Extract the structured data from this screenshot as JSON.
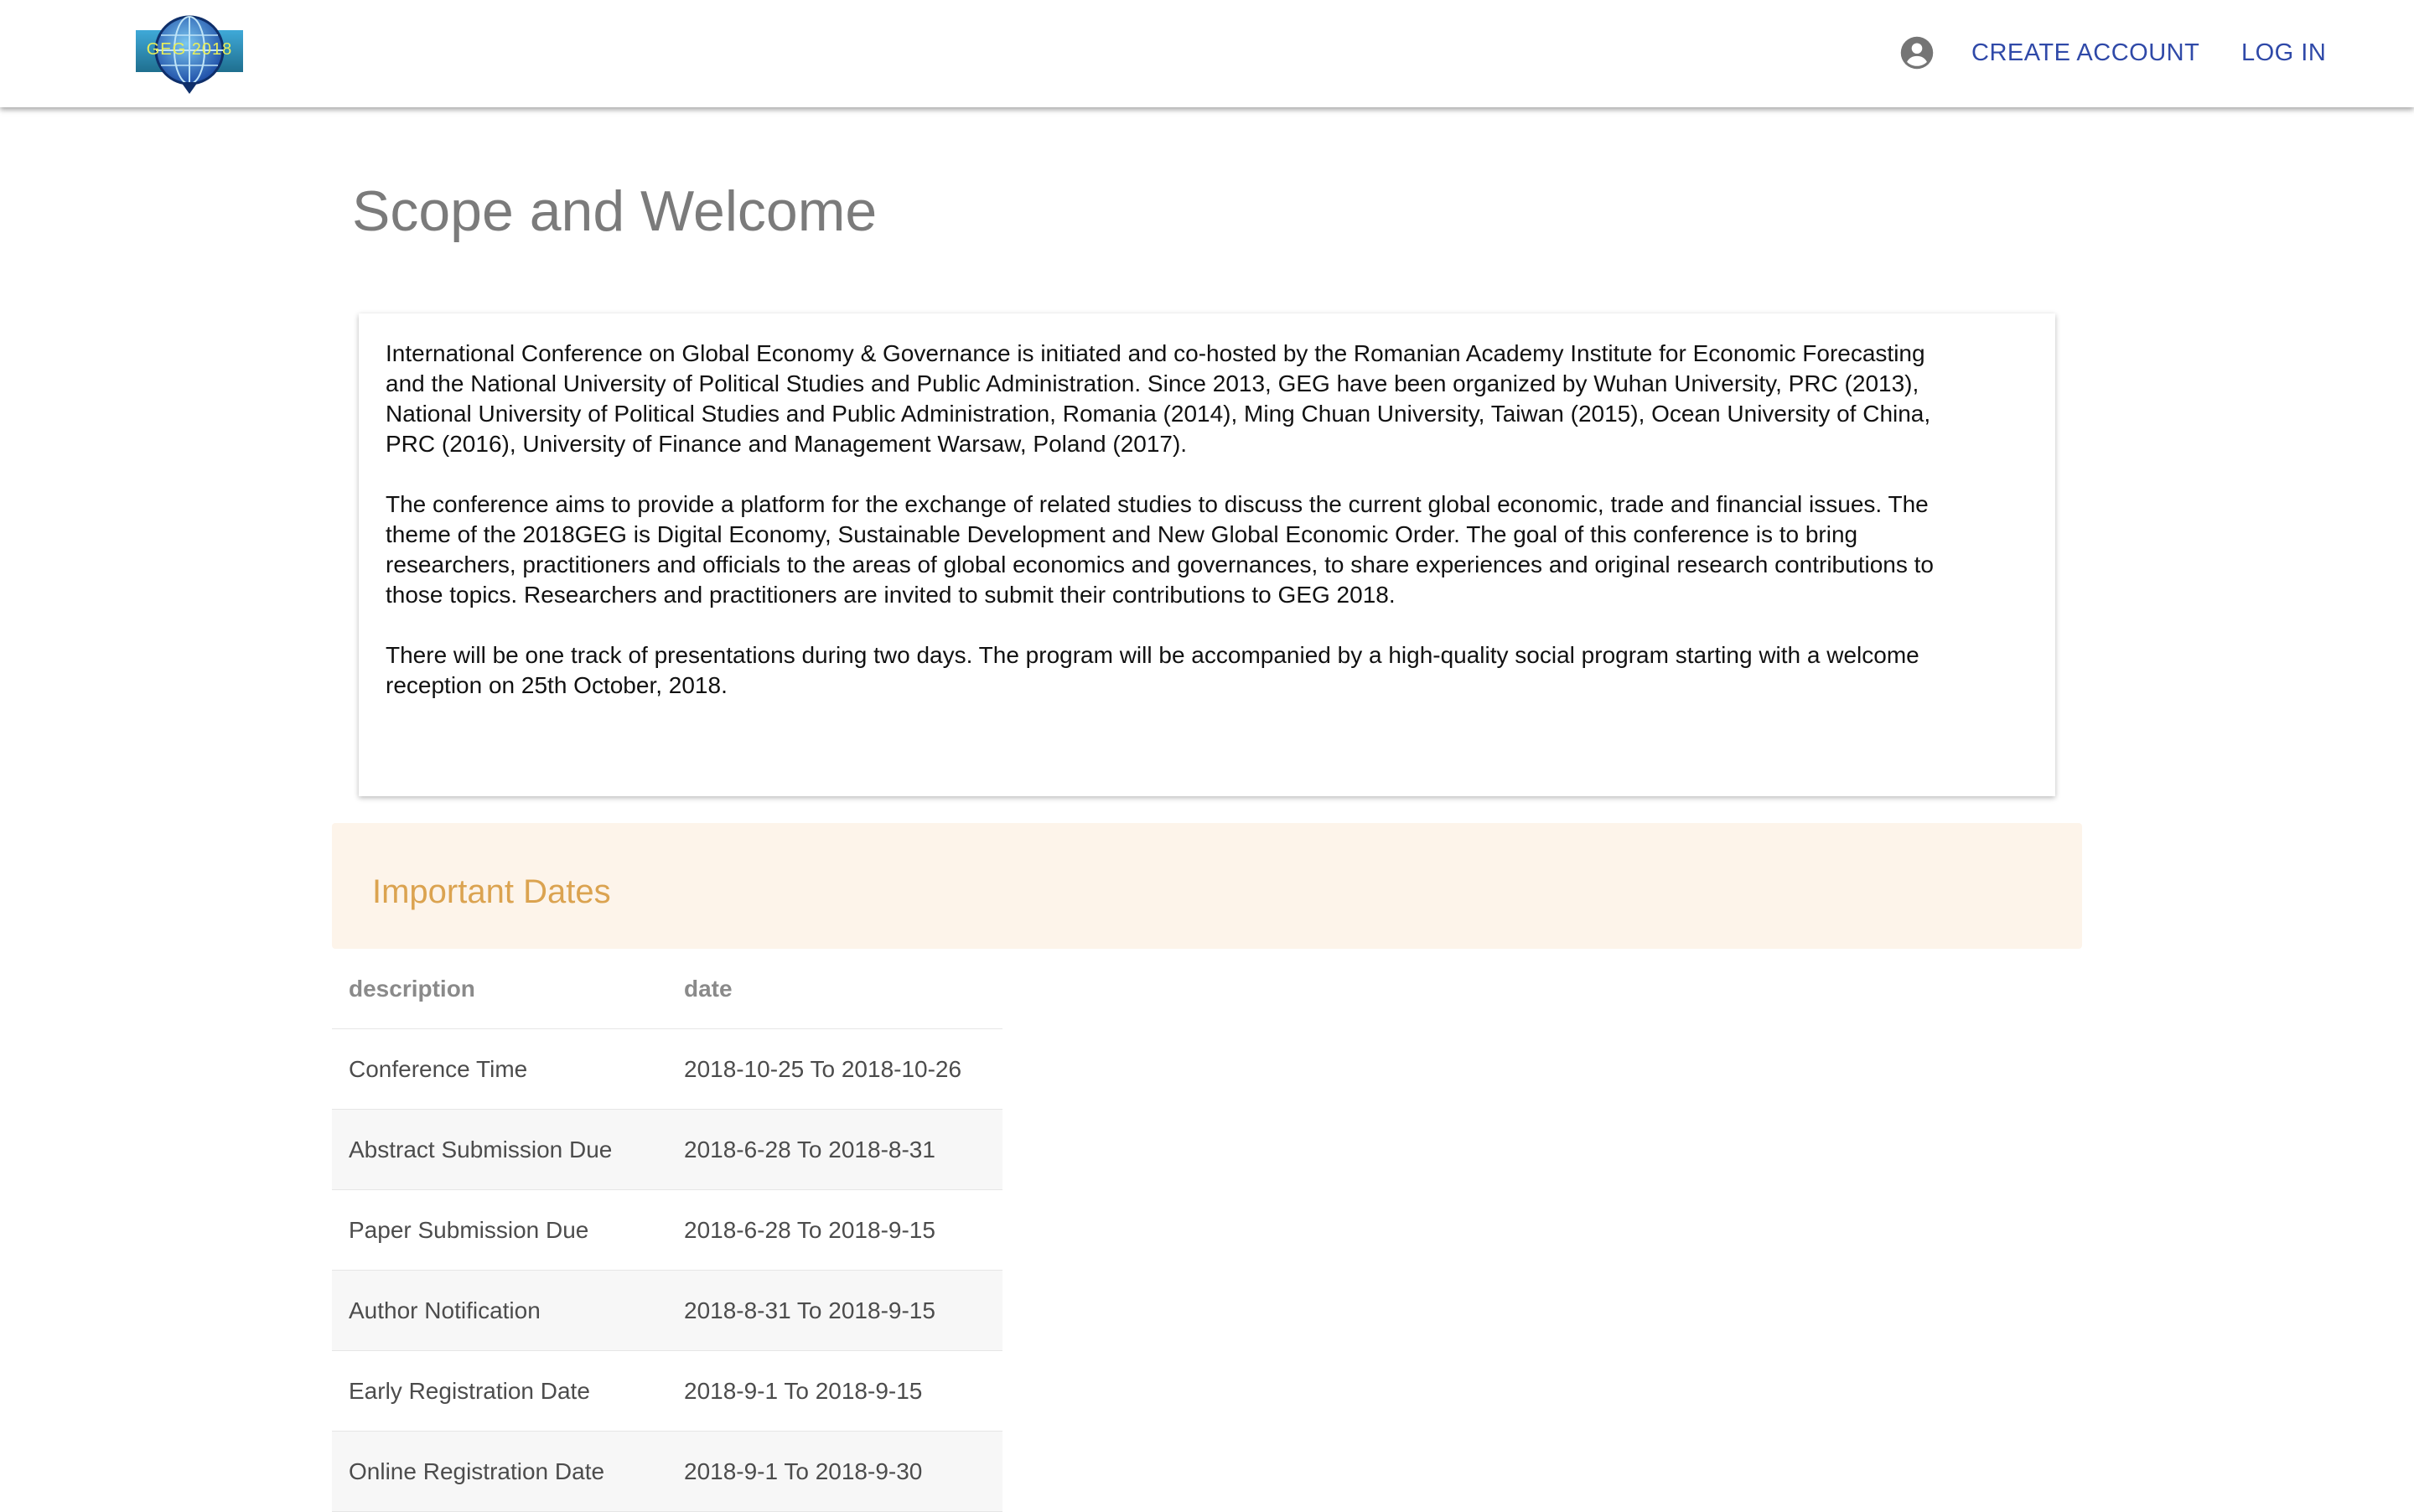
{
  "header": {
    "logo_text": "GEG 2018",
    "account_icon": "account-circle-icon",
    "create_account_label": "CREATE ACCOUNT",
    "login_label": "LOG IN"
  },
  "page": {
    "title": "Scope and Welcome"
  },
  "welcome": {
    "paragraphs": [
      "International Conference on Global Economy & Governance is initiated and co-hosted by the Romanian Academy Institute for Economic Forecasting and the National University of Political Studies and Public Administration. Since 2013, GEG have been organized by Wuhan University, PRC (2013), National University of Political Studies and Public Administration, Romania (2014), Ming Chuan University, Taiwan (2015), Ocean University of China, PRC (2016), University of Finance and Management Warsaw, Poland (2017).",
      "The conference aims to provide a platform for the exchange of related studies to discuss the current global economic, trade and financial issues. The theme of the 2018GEG is Digital Economy, Sustainable Development and New Global Economic Order. The goal of this conference is to bring researchers, practitioners and officials to the areas of global economics and governances, to share experiences and original research contributions to those topics. Researchers and practitioners are invited to submit their contributions to GEG 2018.",
      "There will be one track of presentations during two days. The program will be accompanied by a high-quality social program starting with a welcome reception on 25th October, 2018."
    ]
  },
  "important_dates": {
    "title": "Important Dates",
    "columns": [
      "description",
      "date"
    ],
    "rows": [
      [
        "Conference Time",
        "2018-10-25 To 2018-10-26"
      ],
      [
        "Abstract Submission Due",
        "2018-6-28 To 2018-8-31"
      ],
      [
        "Paper Submission Due",
        "2018-6-28 To 2018-9-15"
      ],
      [
        "Author Notification",
        "2018-8-31 To 2018-9-15"
      ],
      [
        "Early Registration Date",
        "2018-9-1 To 2018-9-15"
      ],
      [
        "Online Registration Date",
        "2018-9-1 To 2018-9-30"
      ]
    ]
  },
  "colors": {
    "link": "#2f49a8",
    "title_gray": "#7b7b7b",
    "dates_accent": "#dba350",
    "dates_header_bg": "#fdf4ea"
  }
}
